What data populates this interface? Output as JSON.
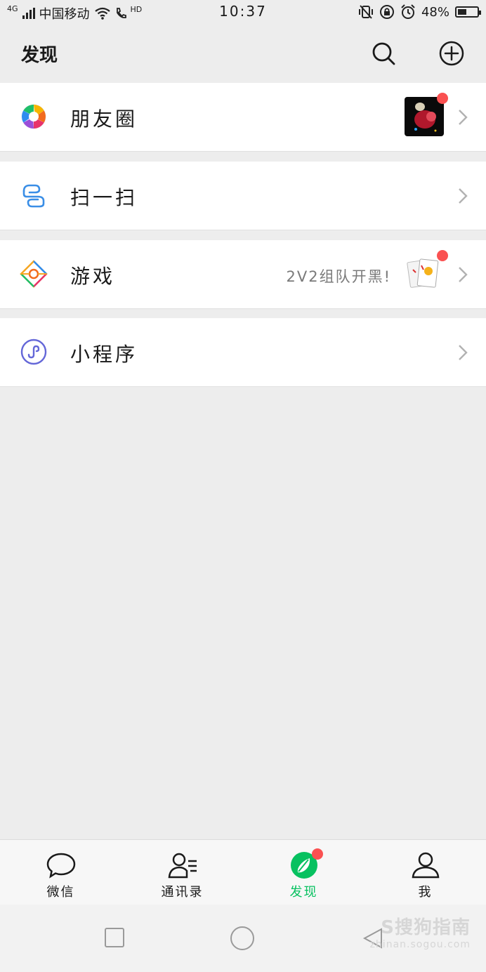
{
  "status_bar": {
    "network": "4G",
    "carrier": "中国移动",
    "call": "HD",
    "time": "10:37",
    "battery_level": "48%",
    "battery_fraction": 0.48
  },
  "header": {
    "title": "发现",
    "search_icon": "search-icon",
    "add_icon": "plus-circle-icon"
  },
  "menu": {
    "moments": {
      "label": "朋友圈",
      "icon": "moments-aperture-icon",
      "has_badge": true
    },
    "scan": {
      "label": "扫一扫",
      "icon": "scan-icon"
    },
    "games": {
      "label": "游戏",
      "hint": "2V2组队开黑!",
      "icon": "games-diamond-icon",
      "has_badge": true
    },
    "mini_programs": {
      "label": "小程序",
      "icon": "mini-program-icon"
    }
  },
  "tabs": [
    {
      "label": "微信",
      "icon": "chat-bubble-icon",
      "active": false
    },
    {
      "label": "通讯录",
      "icon": "contacts-icon",
      "active": false
    },
    {
      "label": "发现",
      "icon": "compass-icon",
      "active": true,
      "has_badge": true
    },
    {
      "label": "我",
      "icon": "person-icon",
      "active": false
    }
  ],
  "watermark": {
    "main": "S搜狗指南",
    "sub": "zhinan.sogou.com"
  },
  "colors": {
    "accent_green": "#07c160",
    "badge_red": "#fa5151",
    "background": "#ededed",
    "mini_program_purple": "#6467d8",
    "scan_blue": "#3a8ee6"
  }
}
